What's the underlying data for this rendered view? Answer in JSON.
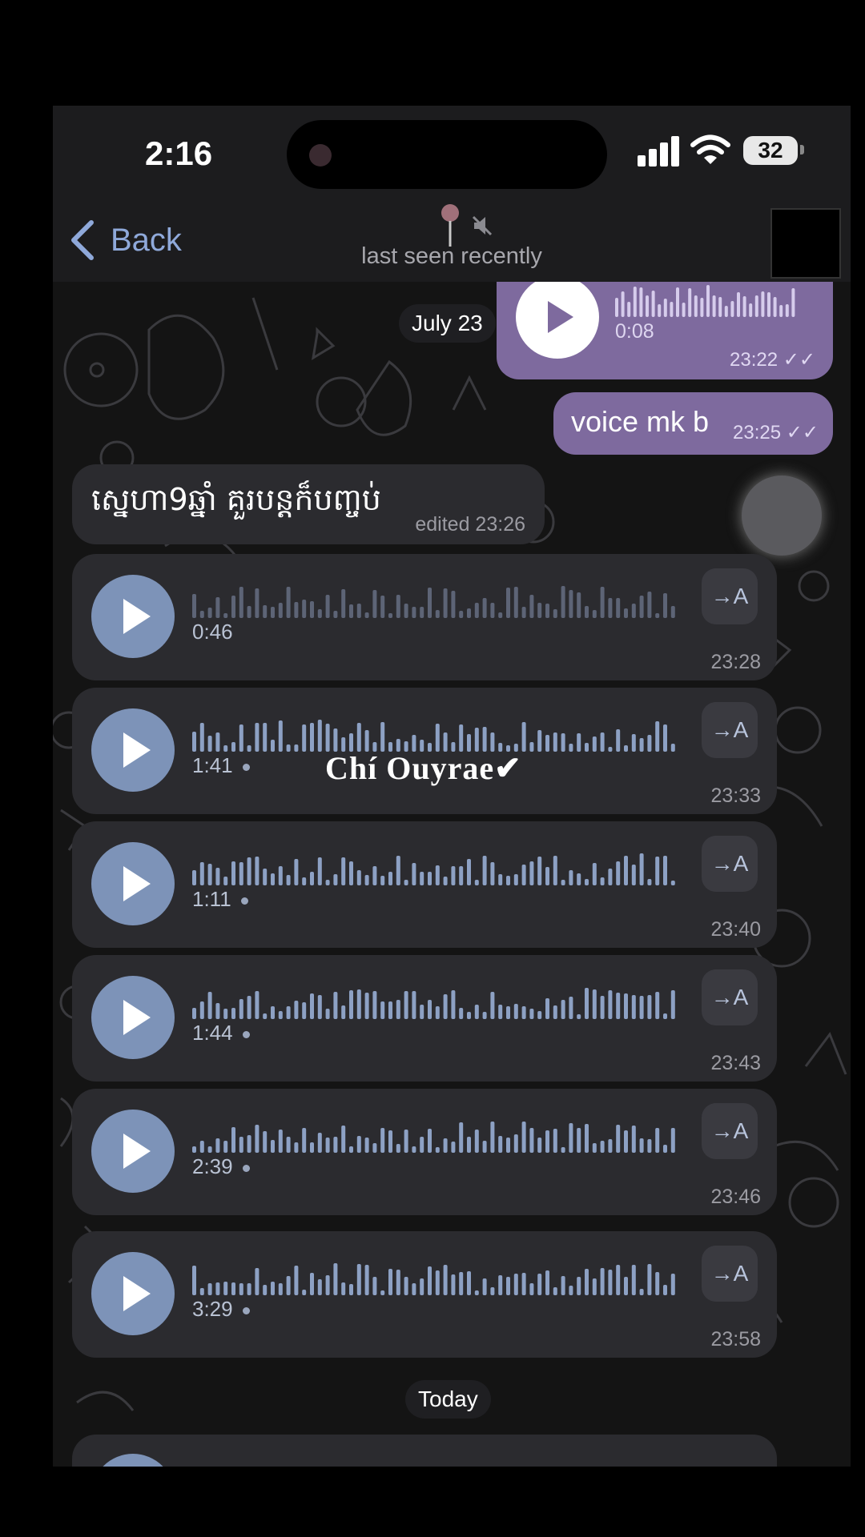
{
  "status_bar": {
    "time": "2:16",
    "battery": "32"
  },
  "header": {
    "back_label": "Back",
    "subtitle": "last seen recently"
  },
  "messages": {
    "date_divider_1": "July 23",
    "out_voice": {
      "duration": "0:08",
      "time": "23:22"
    },
    "out_text": {
      "text": "voice mk b",
      "time": "23:25"
    },
    "in_text": {
      "text": "ស្នេហា9ឆ្នាំ គួរបន្តក៏បញ្ចប់",
      "meta": "edited 23:26"
    },
    "voices": [
      {
        "duration": "0:46",
        "time": "23:28",
        "played": true
      },
      {
        "duration": "1:41",
        "time": "23:33",
        "played": false
      },
      {
        "duration": "1:11",
        "time": "23:40",
        "played": false
      },
      {
        "duration": "1:44",
        "time": "23:43",
        "played": false
      },
      {
        "duration": "2:39",
        "time": "23:46",
        "played": false
      },
      {
        "duration": "3:29",
        "time": "23:58",
        "played": false
      }
    ],
    "translate_label": "→A",
    "date_divider_2": "Today"
  },
  "watermark": "Chí Ouyrae✔",
  "colors": {
    "outgoing_bubble": "#7e6a9e",
    "incoming_bubble": "#2b2b2f",
    "accent_blue": "#7d93b8"
  }
}
